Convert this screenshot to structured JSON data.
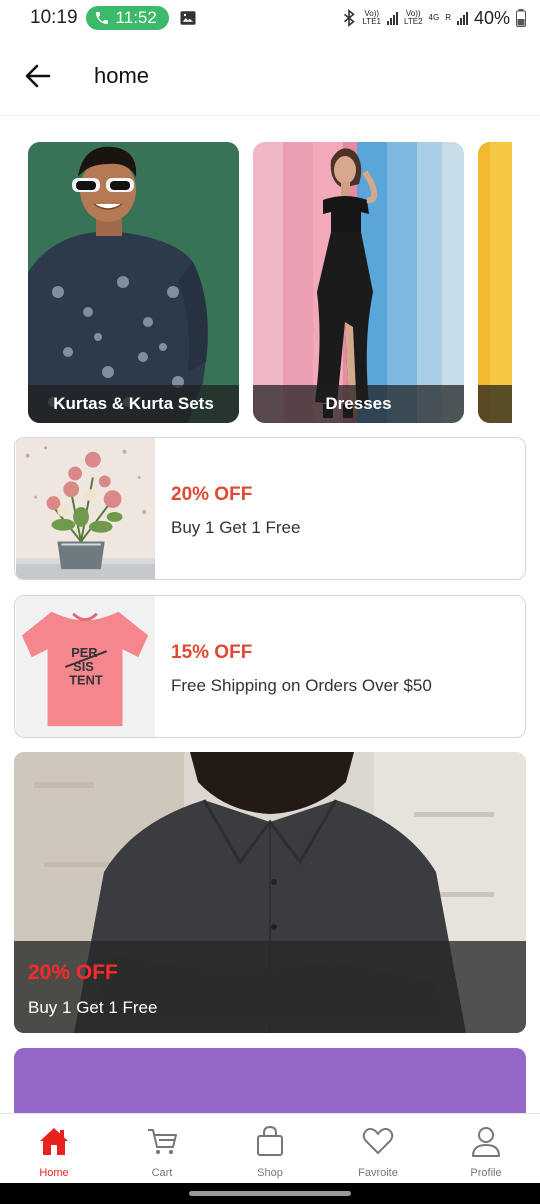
{
  "status_bar": {
    "time": "10:19",
    "call_timer": "11:52",
    "sim1_label": "Vo))\nLTE1",
    "sim2_label": "Vo))\nLTE2",
    "network": "4G",
    "roaming": "R",
    "battery": "40%"
  },
  "header": {
    "title": "home"
  },
  "categories": [
    {
      "label": "Kurtas & Kurta Sets"
    },
    {
      "label": "Dresses"
    },
    {
      "label": ""
    }
  ],
  "offers": [
    {
      "discount": "20% OFF",
      "description": "Buy 1 Get 1 Free"
    },
    {
      "discount": "15% OFF",
      "description": "Free Shipping on Orders Over $50"
    }
  ],
  "banner": {
    "discount": "20% OFF",
    "description": "Buy 1 Get 1 Free"
  },
  "bottom_nav": [
    {
      "label": "Home",
      "icon": "home-icon",
      "active": true
    },
    {
      "label": "Cart",
      "icon": "cart-icon",
      "active": false
    },
    {
      "label": "Shop",
      "icon": "shopping-bag-icon",
      "active": false
    },
    {
      "label": "Favroite",
      "icon": "heart-icon",
      "active": false
    },
    {
      "label": "Profile",
      "icon": "profile-icon",
      "active": false
    }
  ],
  "colors": {
    "accent": "#e8231f",
    "offer_text": "#e04a32",
    "call_pill": "#3cb96a",
    "banner_highlight": "#ff2a2a"
  }
}
